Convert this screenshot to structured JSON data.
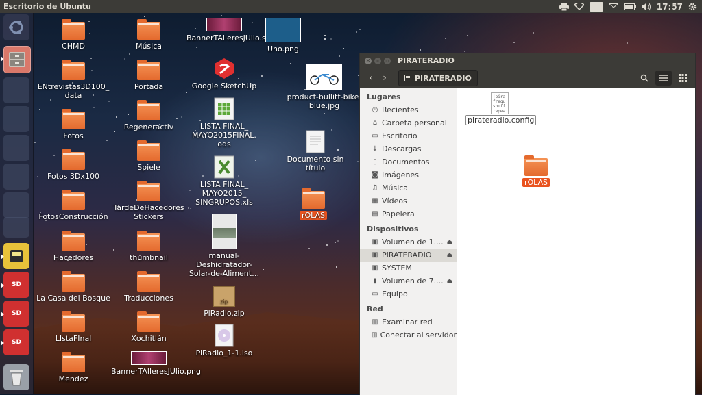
{
  "top_panel": {
    "title": "Escritorio de Ubuntu",
    "keyboard_layout": "Es",
    "clock": "17:57"
  },
  "launcher": {
    "items": [
      "ubuntu-dash",
      "files",
      "app-faded-1",
      "app-faded-2",
      "app-faded-3",
      "app-faded-4",
      "app-faded-5",
      "app-faded-6",
      "app-faded-7",
      "removable-drive",
      "sd-card-1",
      "sd-card-2",
      "sd-card-3",
      "trash"
    ],
    "sd_label": "SD"
  },
  "desktop": {
    "col1": [
      "CHMD",
      "ENtrevistas3D100_ data",
      "Fotos",
      "Fotos 3Dx100",
      "FotosConstrucción",
      "Hacedores",
      "La Casa del Bosque",
      "LIstaFInal",
      "Mendez"
    ],
    "col2": [
      "Música",
      "Portada",
      "Regeneractiv",
      "Spiele",
      "TardeDeHacedores Stickers",
      "thumbnail",
      "Traducciones",
      "Xochitlán",
      "BannerTAlleresJUlio.png"
    ],
    "col3": [
      "BannerTAlleresJUlio.svg",
      "Google SketchUp",
      "LISTA FINAL_ MAYO2015FINAL. ods",
      "LISTA FINAL_ MAYO2015_ SINGRUPOS.xls",
      "manual-Deshidratador-Solar-de-Aliment…",
      "PiRadio.zip",
      "PiRadio_1-1.iso"
    ],
    "col4": [
      "Uno.png",
      "product-bullitt-bike-blue.jpg",
      "Documento sin título",
      "rOLAS"
    ],
    "zip_label": "zip"
  },
  "window": {
    "title": "PIRATERADIO",
    "path": "PIRATERADIO",
    "sidebar": {
      "places_header": "Lugares",
      "places": [
        {
          "label": "Recientes",
          "icon": "clock-icon"
        },
        {
          "label": "Carpeta personal",
          "icon": "home-icon"
        },
        {
          "label": "Escritorio",
          "icon": "desktop-icon"
        },
        {
          "label": "Descargas",
          "icon": "download-icon"
        },
        {
          "label": "Documentos",
          "icon": "document-icon"
        },
        {
          "label": "Imágenes",
          "icon": "camera-icon"
        },
        {
          "label": "Música",
          "icon": "music-icon"
        },
        {
          "label": "Vídeos",
          "icon": "video-icon"
        },
        {
          "label": "Papelera",
          "icon": "trash-icon"
        }
      ],
      "devices_header": "Dispositivos",
      "devices": [
        {
          "label": "Volumen de 1....",
          "icon": "drive-icon",
          "eject": true
        },
        {
          "label": "PIRATERADIO",
          "icon": "drive-icon",
          "eject": true,
          "selected": true
        },
        {
          "label": "SYSTEM",
          "icon": "drive-icon",
          "eject": false
        },
        {
          "label": "Volumen de 7....",
          "icon": "usb-icon",
          "eject": true
        },
        {
          "label": "Equipo",
          "icon": "computer-icon",
          "eject": false
        }
      ],
      "network_header": "Red",
      "network": [
        {
          "label": "Examinar red",
          "icon": "network-icon"
        },
        {
          "label": "Conectar al servidor",
          "icon": "server-icon"
        }
      ]
    },
    "files": [
      {
        "name": "pirateradio.config",
        "type": "text",
        "preview": [
          "|pira",
          "frequ",
          "shuff",
          "repea"
        ]
      },
      {
        "name": "rOLAS",
        "type": "folder"
      }
    ]
  }
}
